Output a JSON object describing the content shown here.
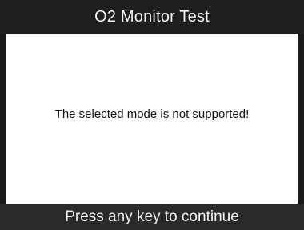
{
  "header": {
    "title": "O2 Monitor Test"
  },
  "main": {
    "message": "The selected mode is not supported!"
  },
  "footer": {
    "prompt": "Press any key to continue"
  },
  "colors": {
    "frame": "#1a1a1a",
    "content_bg": "#ffffff",
    "header_text": "#f2f2f2",
    "message_text": "#111111"
  }
}
